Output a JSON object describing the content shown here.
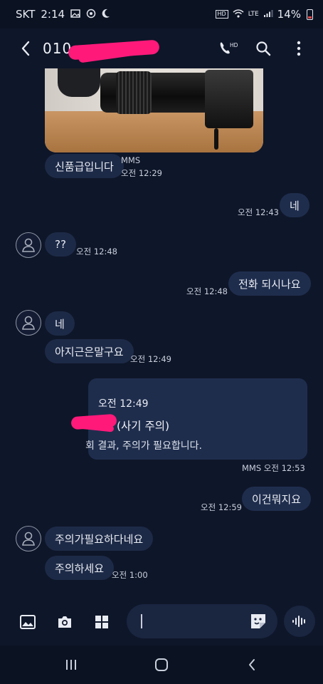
{
  "status_bar": {
    "carrier": "SKT",
    "time": "2:14",
    "hd_voice": "HD",
    "network": "LTE",
    "battery": "14%",
    "battery_level": 0.14
  },
  "header": {
    "phone_number": "010",
    "icons": [
      "back-icon",
      "hd-call-icon",
      "search-icon",
      "more-icon"
    ],
    "hd_label": "HD"
  },
  "messages": {
    "m1": {
      "text": "신품급입니다",
      "tag": "MMS",
      "time": "오전 12:29"
    },
    "m2": {
      "text": "네",
      "time": "오전 12:43"
    },
    "m3": {
      "text": "??",
      "time": "오전 12:48"
    },
    "m4": {
      "text": "전화 되시나요",
      "time": "오전 12:48"
    },
    "m5": {
      "text": "네"
    },
    "m6": {
      "text": "아지근은말구요",
      "time": "오전 12:49"
    },
    "card": {
      "time": "오전 12:49",
      "title": "(사기 주의)",
      "body": "회 결과, 주의가 필요합니다.",
      "meta": "MMS 오전 12:53"
    },
    "m7": {
      "text": "이건뭐지요",
      "time": "오전 12:59"
    },
    "m8": {
      "text": "주의가필요하다네요"
    },
    "m9": {
      "text": "주의하세요",
      "time": "오전 1:00"
    }
  },
  "composer": {
    "icons": [
      "gallery-icon",
      "camera-icon",
      "apps-icon",
      "sticker-icon",
      "voice-icon"
    ]
  },
  "navbar": {
    "icons": [
      "recents-icon",
      "home-icon",
      "back-nav-icon"
    ]
  },
  "colors": {
    "background": "#0e1629",
    "bubble": "#1d2a47",
    "redaction": "#ff1a7a"
  }
}
